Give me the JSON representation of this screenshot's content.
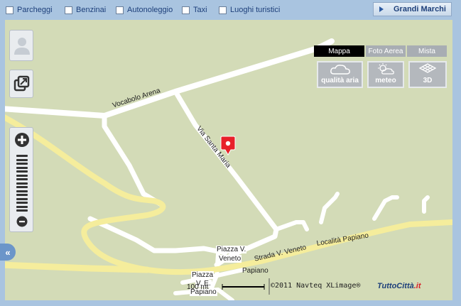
{
  "layers": {
    "items": [
      {
        "label": "Parcheggi",
        "checked": false
      },
      {
        "label": "Benzinai",
        "checked": false
      },
      {
        "label": "Autonoleggio",
        "checked": false
      },
      {
        "label": "Taxi",
        "checked": false
      },
      {
        "label": "Luoghi turistici",
        "checked": false
      }
    ]
  },
  "grandi_marchi": {
    "label": "Grandi Marchi"
  },
  "map_types": {
    "tabs": [
      {
        "label": "Mappa",
        "active": true
      },
      {
        "label": "Foto Aerea",
        "active": false
      },
      {
        "label": "Mista",
        "active": false
      }
    ]
  },
  "overlays": {
    "buttons": [
      {
        "label": "qualità aria",
        "icon": "cloud-icon"
      },
      {
        "label": "meteo",
        "icon": "sun-cloud-icon"
      },
      {
        "label": "3D",
        "icon": "3d-grid-icon"
      }
    ]
  },
  "controls": {
    "street_view_icon": "person-icon",
    "expand_icon": "expand-window-icon",
    "zoom_in_symbol": "+",
    "zoom_out_symbol": "−",
    "zoom_levels": 15,
    "collapse_symbol": "«"
  },
  "map": {
    "labels": {
      "vocabolo_arena": "Vocabolo Arena",
      "via_santa_maria": "Via Santa Maria",
      "strada_v_veneto": "Strada V. Veneto",
      "localita_papiano": "Località Papiano",
      "piazza_v_veneto_1": "Piazza V.",
      "piazza_v_veneto_1b": "Veneto",
      "papiano": "Papiano",
      "piazza_v_veneto_2": "Piazza",
      "piazza_v_veneto_2b": "V. E.",
      "papiano_2": "Papiano"
    },
    "colors": {
      "background": "#d3dbb7",
      "road": "#ffffff",
      "main_road": "#f5ed9c",
      "marker": "#e8202a"
    }
  },
  "footer": {
    "scale": "100 mt",
    "copyright": "©2011 Navteq XLimage®",
    "logo_main": "TuttoCittà",
    "logo_suffix": ".it"
  }
}
